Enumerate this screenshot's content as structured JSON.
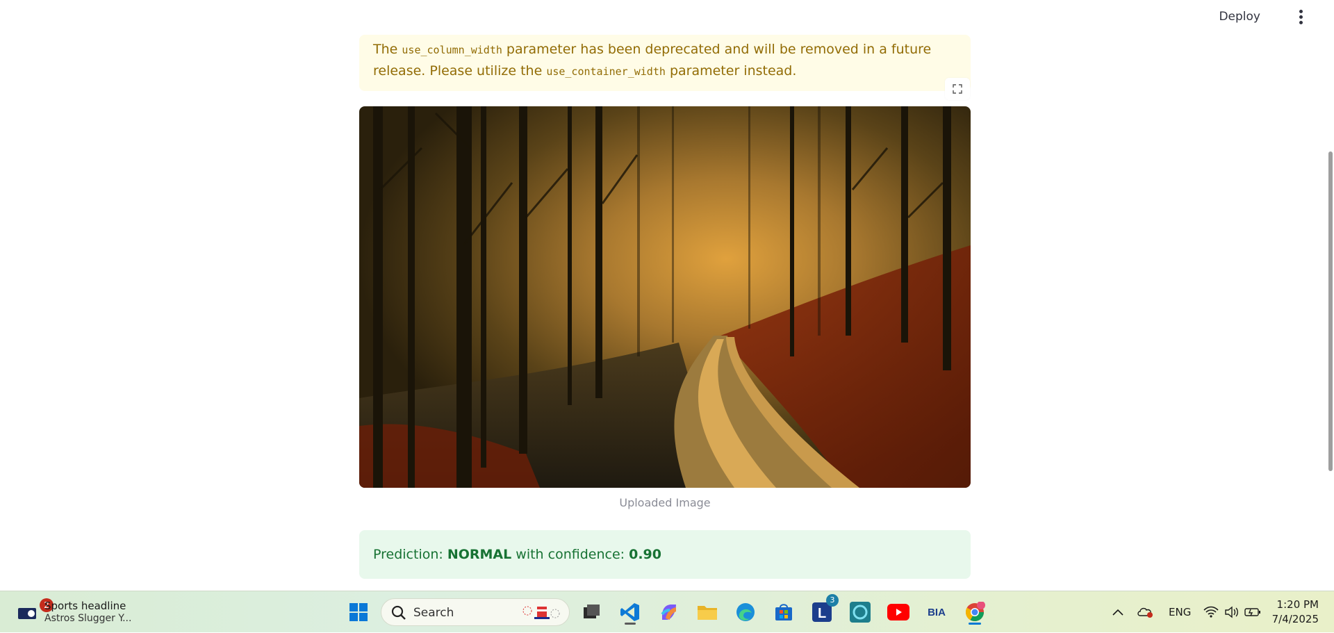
{
  "header": {
    "deploy_label": "Deploy",
    "menu_icon": "more-vertical-icon"
  },
  "warning": {
    "text_1": "The ",
    "code_1": "use_column_width",
    "text_2": " parameter has been deprecated and will be removed in a future release. Please utilize the ",
    "code_2": "use_container_width",
    "text_3": " parameter instead."
  },
  "image": {
    "caption": "Uploaded Image",
    "fullscreen_icon": "fullscreen-icon"
  },
  "result": {
    "prefix": "Prediction: ",
    "label": "NORMAL",
    "middle": " with confidence: ",
    "confidence": "0.90"
  },
  "taskbar": {
    "news_badge": "2",
    "news_title": "Sports headline",
    "news_subtitle": "Astros Slugger Y...",
    "search_label": "Search",
    "apps": [
      "start-icon",
      "task-view-icon",
      "vscode-icon",
      "copilot-icon",
      "file-explorer-icon",
      "edge-icon",
      "store-icon",
      "l-app-icon",
      "alexa-icon",
      "youtube-icon",
      "bia-icon",
      "chrome-icon"
    ],
    "l_app_badge": "3",
    "bia_label": "BIA",
    "tray_lang": "ENG",
    "time": "1:20 PM",
    "date": "7/4/2025"
  }
}
